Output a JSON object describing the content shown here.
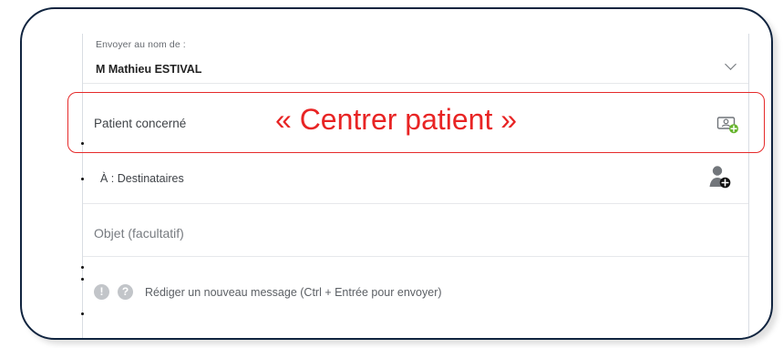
{
  "form": {
    "sender_label": "Envoyer au nom de :",
    "sender_name": "M Mathieu ESTIVAL",
    "patient_label": "Patient concerné",
    "callout": "« Centrer patient »",
    "recipient_label": "À : Destinataires",
    "subject_placeholder": "Objet (facultatif)",
    "message_placeholder": "Rédiger un nouveau message (Ctrl + Entrée pour envoyer)"
  },
  "icons": {
    "sender_dropdown": "chevron-down-icon",
    "patient_action": "patient-card-add-icon",
    "recipient_action": "user-add-icon",
    "info": "info-icon",
    "help": "help-icon"
  },
  "colors": {
    "frame": "#10243f",
    "highlight": "#e52a2a",
    "callout": "#e82424",
    "icon_gray": "#6f7378",
    "icon_green": "#68b52f"
  }
}
